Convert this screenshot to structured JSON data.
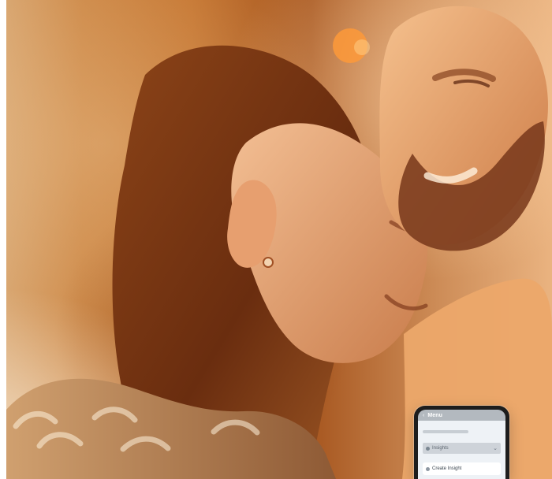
{
  "screen": {
    "content": "photo",
    "background": "#ffffff",
    "accent": "#c77935"
  },
  "phone": {
    "title": "Menu",
    "back_icon": "back-icon",
    "row_label": "Insights",
    "card_label": "Create Insight"
  }
}
